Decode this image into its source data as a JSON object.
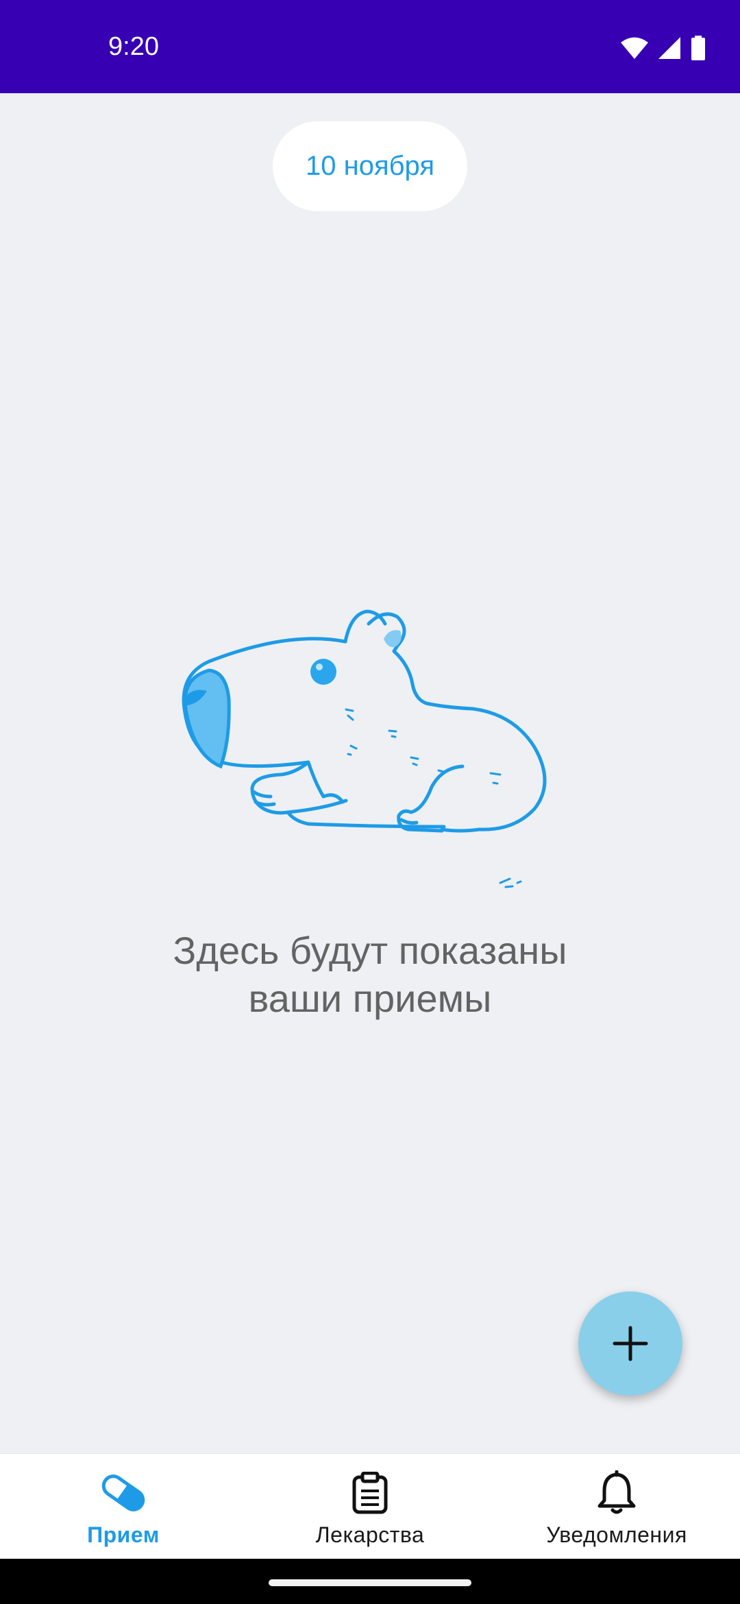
{
  "status_bar": {
    "time": "9:20",
    "icons": [
      "wifi-icon",
      "cellular-signal-icon",
      "battery-icon"
    ]
  },
  "date_pill": {
    "label": "10 ноября"
  },
  "empty_state": {
    "illustration": "capybara-illustration",
    "line1": "Здесь будут показаны",
    "line2": "ваши приемы"
  },
  "fab": {
    "icon": "plus-icon"
  },
  "bottom_nav": {
    "items": [
      {
        "label": "Прием",
        "icon": "pill-icon",
        "active": true
      },
      {
        "label": "Лекарства",
        "icon": "clipboard-icon",
        "active": false
      },
      {
        "label": "Уведомления",
        "icon": "bell-icon",
        "active": false
      }
    ]
  },
  "colors": {
    "status_bar": "#3700B3",
    "accent": "#1E9BE6",
    "background": "#EEF0F3",
    "fab": "#8ACFEA",
    "empty_text": "#636363"
  }
}
